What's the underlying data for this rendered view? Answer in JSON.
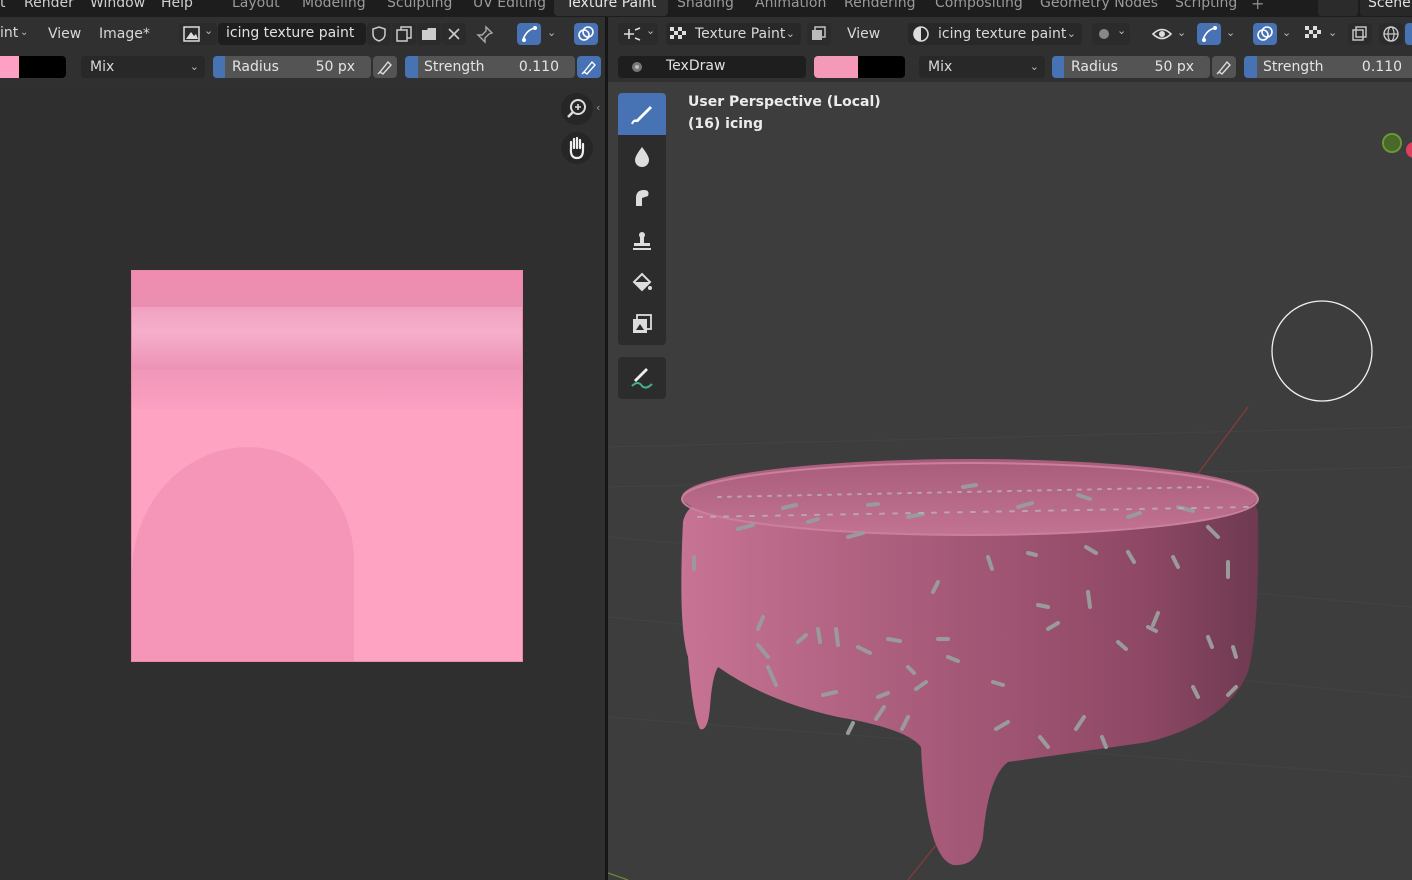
{
  "topbar": {
    "menus": [
      "t",
      "Render",
      "Window",
      "Help"
    ],
    "workspaces": [
      "Layout",
      "Modeling",
      "Sculpting",
      "UV Editing",
      "Texture Paint",
      "Shading",
      "Animation",
      "Rendering",
      "Compositing",
      "Geometry Nodes",
      "Scripting"
    ],
    "active_workspace": "Texture Paint",
    "add_workspace": "+",
    "scene": "Scene"
  },
  "image_editor": {
    "header": {
      "mode_label": "int",
      "view_menu": "View",
      "image_menu": "Image*",
      "image_name": "icing texture paint"
    },
    "tool_settings": {
      "blend_mode": "Mix",
      "radius_label": "Radius",
      "radius_value": "50 px",
      "strength_label": "Strength",
      "strength_value": "0.110",
      "primary_color": "#ff9fc4",
      "secondary_color": "#000000"
    },
    "nav_icons": [
      "zoom-icon",
      "hand-pan-icon"
    ]
  },
  "viewport": {
    "header": {
      "mode": "Texture Paint",
      "view_menu": "View",
      "image_name": "icing texture paint"
    },
    "tool_settings": {
      "brush_name": "TexDraw",
      "blend_mode": "Mix",
      "radius_label": "Radius",
      "radius_value": "50 px",
      "strength_label": "Strength",
      "strength_value": "0.110",
      "primary_color": "#f49ab8",
      "secondary_color": "#000000"
    },
    "overlay_text": {
      "perspective": "User Perspective (Local)",
      "object": "(16) icing"
    },
    "tools": [
      "draw-brush-icon",
      "soften-brush-icon",
      "smear-brush-icon",
      "clone-brush-icon",
      "fill-brush-icon",
      "mask-brush-icon",
      "annotate-icon"
    ]
  },
  "colors": {
    "accent": "#4772b3",
    "icing": "#b8607f",
    "texture_pink": "#ffa3c3"
  }
}
